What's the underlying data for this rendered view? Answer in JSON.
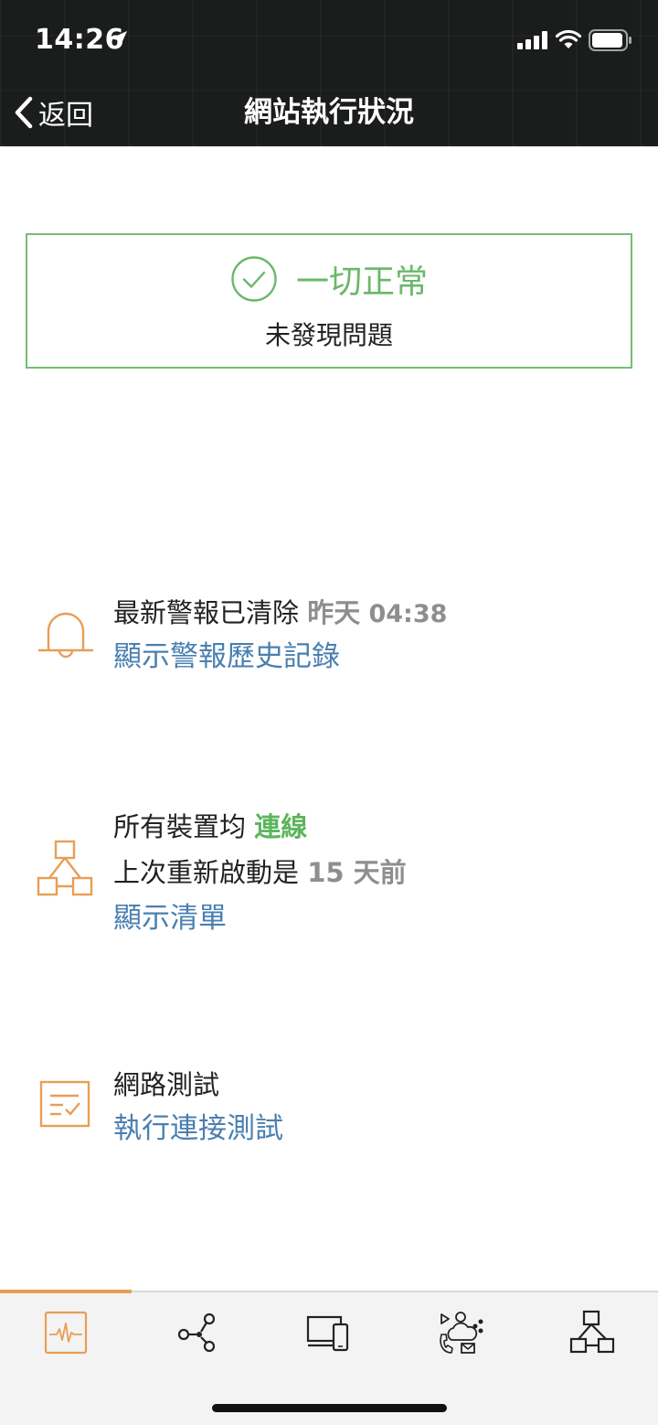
{
  "status_bar": {
    "time": "14:26"
  },
  "nav": {
    "back_label": "返回",
    "title": "網站執行狀況"
  },
  "status_card": {
    "headline": "一切正常",
    "subtitle": "未發現問題"
  },
  "alerts": {
    "text": "最新警報已清除",
    "time_day": "昨天",
    "time_clock": "04:38",
    "link": "顯示警報歷史記錄"
  },
  "devices": {
    "text_prefix": "所有裝置均",
    "status": "連線",
    "reboot_prefix": "上次重新啟動是",
    "reboot_value": "15 天前",
    "link": "顯示清單"
  },
  "network_test": {
    "title": "網路測試",
    "link": "執行連接測試"
  },
  "colors": {
    "accent": "#e89e56",
    "ok_green": "#6ab86a",
    "link_blue": "#4a7fb1",
    "muted_gray": "#8e8e8e"
  },
  "tabs": [
    {
      "icon": "pulse-icon",
      "active": true
    },
    {
      "icon": "share-nodes-icon",
      "active": false
    },
    {
      "icon": "devices-icon",
      "active": false
    },
    {
      "icon": "services-icon",
      "active": false
    },
    {
      "icon": "topology-icon",
      "active": false
    }
  ]
}
